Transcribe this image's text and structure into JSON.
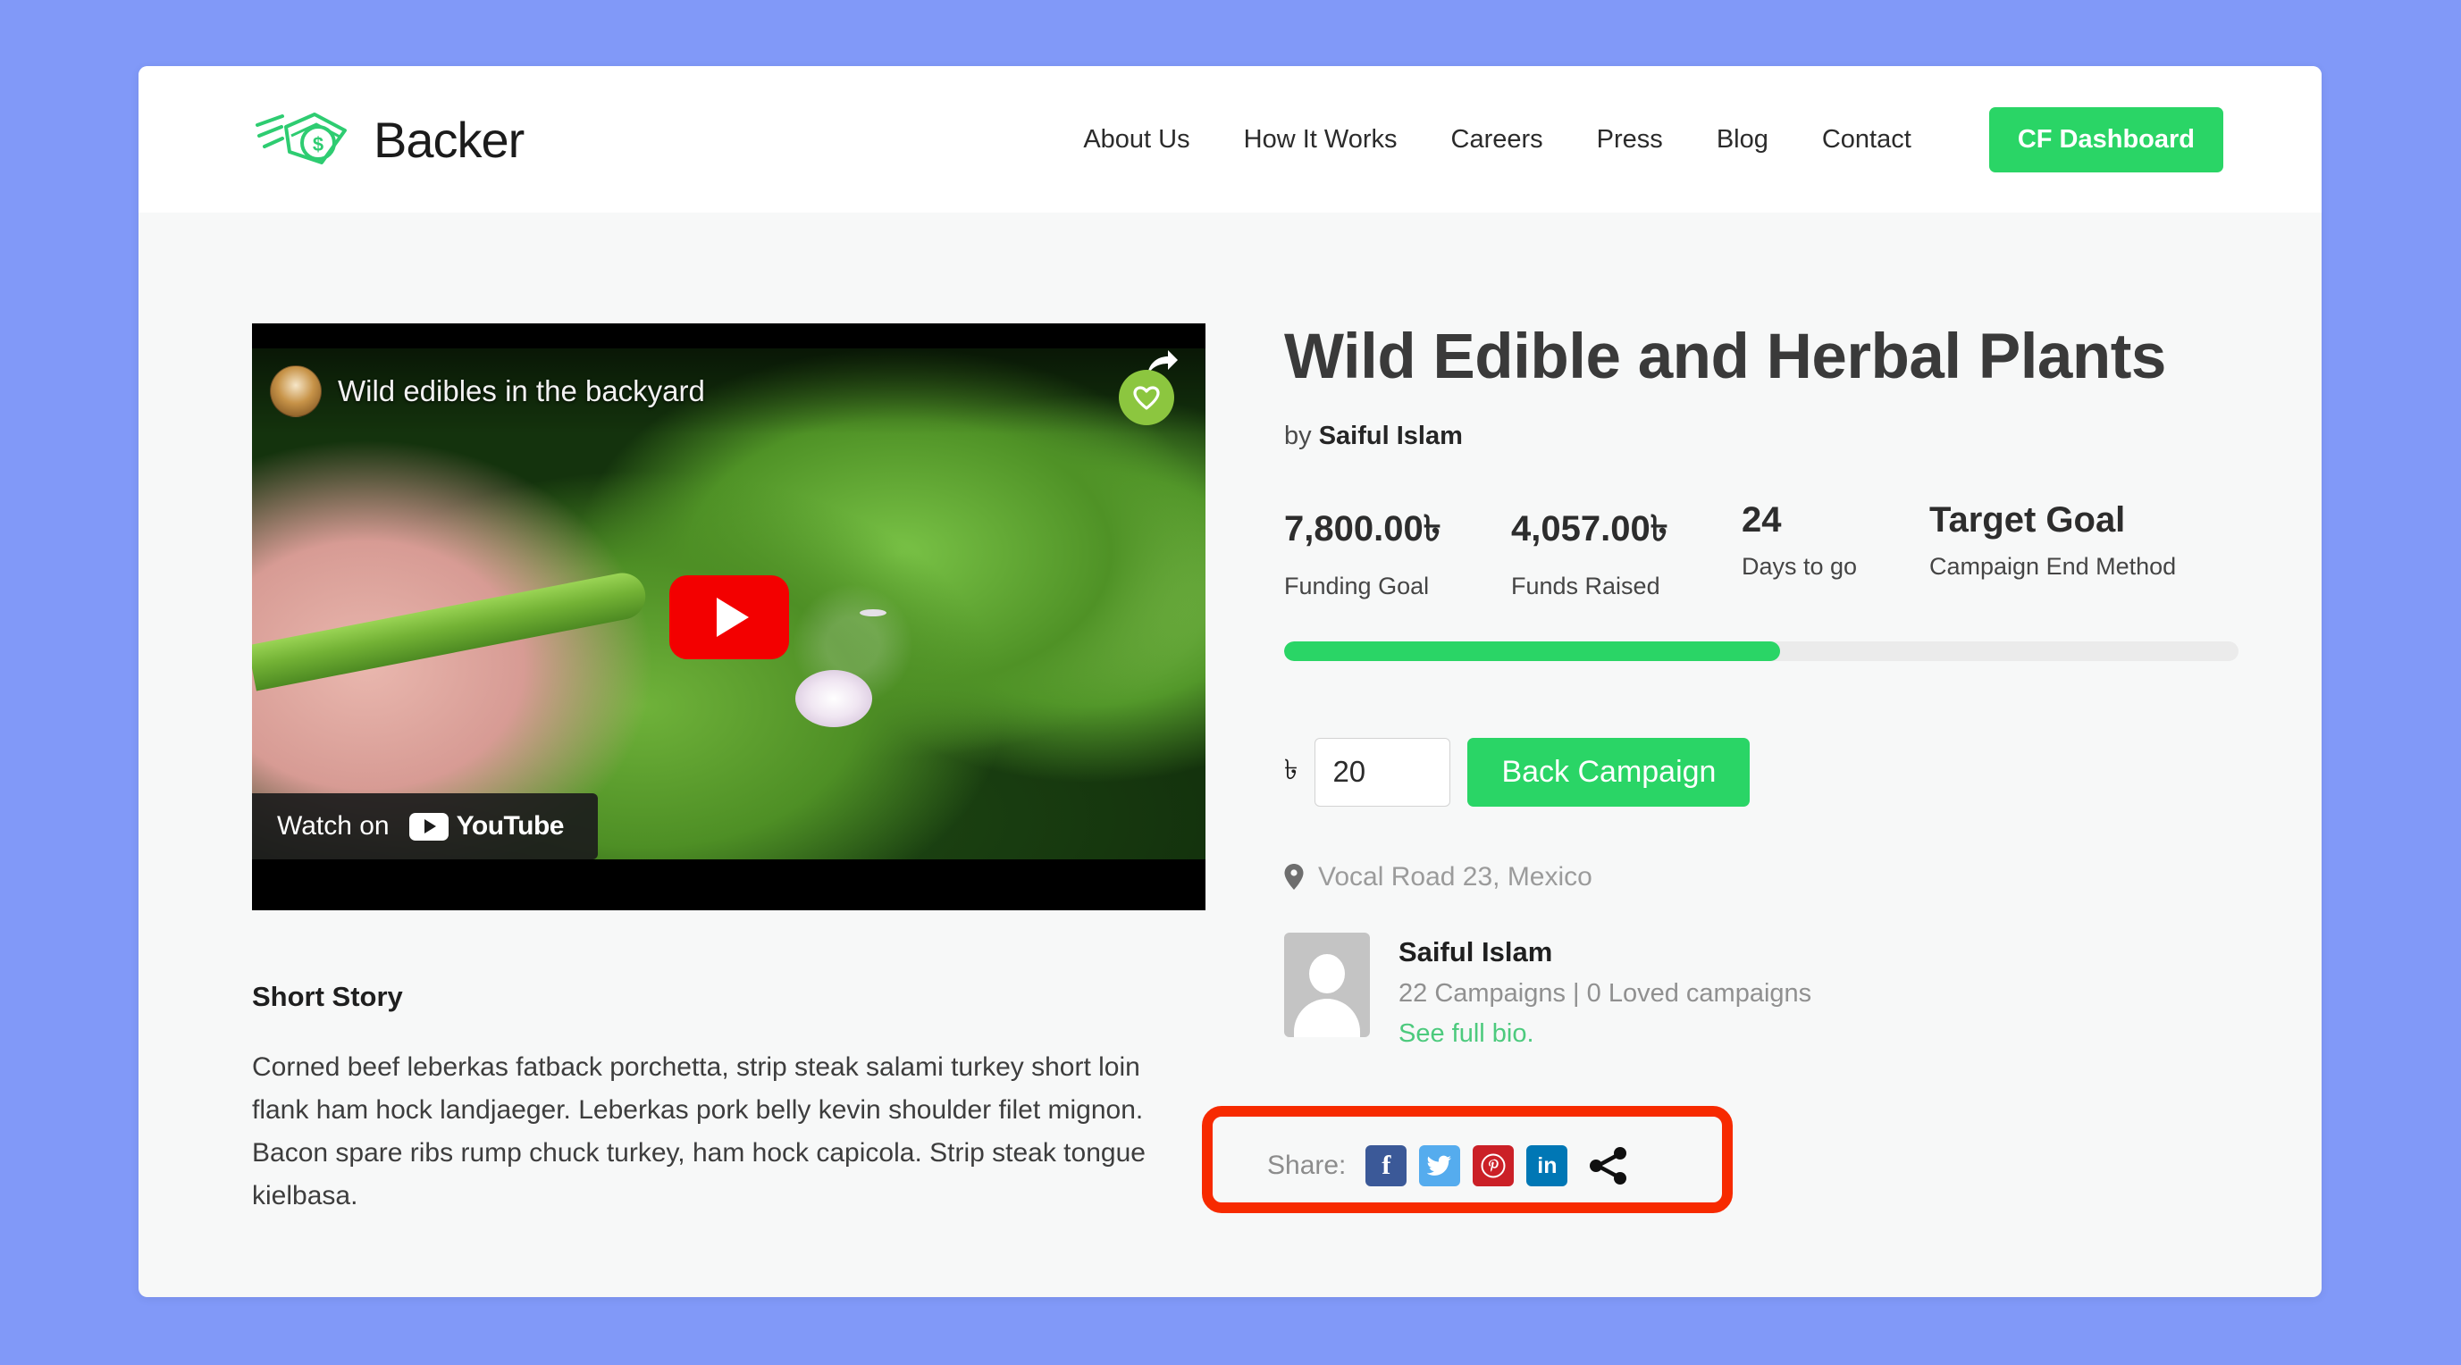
{
  "brand": {
    "name": "Backer",
    "logo_icon": "money-stack-icon"
  },
  "nav": {
    "items": [
      {
        "label": "About Us"
      },
      {
        "label": "How It Works"
      },
      {
        "label": "Careers"
      },
      {
        "label": "Press"
      },
      {
        "label": "Blog"
      },
      {
        "label": "Contact"
      }
    ],
    "cta_label": "CF Dashboard",
    "cta_color": "#2ad566"
  },
  "video": {
    "title": "Wild edibles in the backyard",
    "watch_on_label": "Watch on",
    "youtube_label": "YouTube",
    "play_icon": "play-icon",
    "like_icon": "heart-icon",
    "share_icon": "share-arrow-icon",
    "channel_avatar_icon": "channel-avatar-icon"
  },
  "story": {
    "heading": "Short Story",
    "body": "Corned beef leberkas fatback porchetta, strip steak salami turkey short loin flank ham hock landjaeger. Leberkas pork belly kevin shoulder filet mignon. Bacon spare ribs rump chuck turkey, ham hock capicola. Strip steak tongue kielbasa."
  },
  "campaign": {
    "title": "Wild Edible and Herbal Plants",
    "by_prefix": "by ",
    "author": "Saiful Islam",
    "stats": [
      {
        "value": "7,800.00৳",
        "label": "Funding Goal"
      },
      {
        "value": "4,057.00৳",
        "label": "Funds Raised"
      },
      {
        "value": "24",
        "label": "Days to go"
      },
      {
        "value": "Target Goal",
        "label": "Campaign End Method"
      }
    ],
    "progress_percent": 52,
    "currency_symbol": "৳",
    "amount_value": "20",
    "amount_placeholder": "20",
    "back_button_label": "Back Campaign",
    "location": "Vocal Road 23, Mexico",
    "location_icon": "map-pin-icon"
  },
  "author_card": {
    "name": "Saiful Islam",
    "meta": "22 Campaigns | 0 Loved campaigns",
    "bio_link": "See full bio.",
    "avatar_icon": "user-avatar-icon"
  },
  "share": {
    "label": "Share:",
    "buttons": [
      {
        "name": "facebook",
        "glyph": "f",
        "color": "#3b5998"
      },
      {
        "name": "twitter",
        "glyph": "",
        "color": "#55acee"
      },
      {
        "name": "pinterest",
        "glyph": "",
        "color": "#cb2027"
      },
      {
        "name": "linkedin",
        "glyph": "in",
        "color": "#0077b5"
      }
    ],
    "more_icon": "share-nodes-icon",
    "highlight_color": "#f72a00"
  }
}
